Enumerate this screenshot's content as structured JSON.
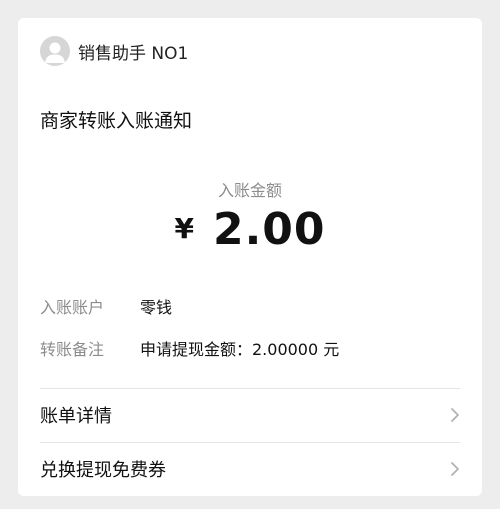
{
  "account": {
    "name": "销售助手 NO1",
    "avatar_icon": "user-avatar-icon"
  },
  "notice": {
    "title": "商家转账入账通知"
  },
  "amount": {
    "label": "入账金额",
    "currency": "¥",
    "value": "2.00"
  },
  "details": [
    {
      "label": "入账账户",
      "value": "零钱"
    },
    {
      "label": "转账备注",
      "value": "申请提现金额：2.00000 元"
    }
  ],
  "links": [
    {
      "label": "账单详情",
      "icon": "chevron-right-icon"
    },
    {
      "label": "兑换提现免费券",
      "icon": "chevron-right-icon"
    }
  ],
  "colors": {
    "background": "#ededed",
    "card": "#ffffff",
    "secondary_text": "#8c8c8c",
    "primary_text": "#111111"
  }
}
